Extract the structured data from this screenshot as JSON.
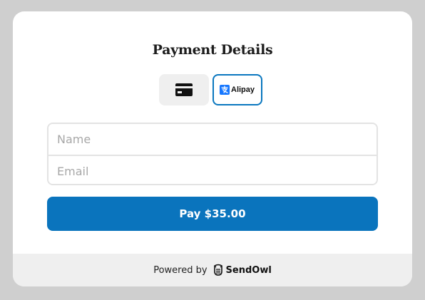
{
  "form": {
    "title": "Payment Details",
    "methods": [
      {
        "id": "card",
        "icon": "credit-card-icon",
        "selected": false
      },
      {
        "id": "alipay",
        "label": "Alipay",
        "icon": "alipay-logo",
        "selected": true
      }
    ],
    "name_placeholder": "Name",
    "email_placeholder": "Email",
    "pay_label": "Pay $35.00"
  },
  "footer": {
    "powered_by": "Powered by",
    "brand": "SendOwl",
    "brand_icon": "owl-icon"
  },
  "colors": {
    "page_bg": "#cfcfcf",
    "accent": "#0a74bd",
    "alipay_blue": "#1677ff",
    "footer_bg": "#efefef"
  }
}
